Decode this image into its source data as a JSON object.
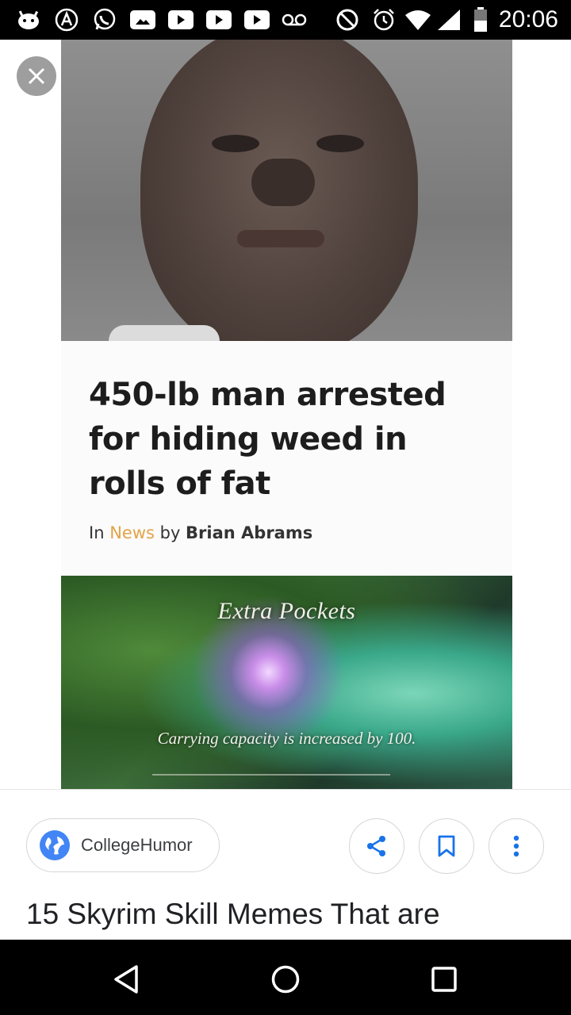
{
  "status_bar": {
    "time": "20:06",
    "icons": [
      "android-debug-icon",
      "app-icon",
      "whatsapp-icon",
      "gallery-icon",
      "youtube-icon",
      "youtube-icon",
      "youtube-icon",
      "voicemail-icon",
      "do-not-disturb-icon",
      "alarm-icon",
      "wifi-icon",
      "signal-icon",
      "battery-icon"
    ]
  },
  "viewer": {
    "close_icon": "close-icon",
    "meme": {
      "headline": "450-lb man arrested for hiding weed in rolls of fat",
      "byline_prefix": "In ",
      "byline_category": "News",
      "byline_mid": " by ",
      "byline_author": "Brian Abrams",
      "perk_title": "Extra Pockets",
      "perk_description": "Carrying capacity is increased by 100."
    }
  },
  "info": {
    "source_name": "CollegeHumor",
    "source_icon": "globe-icon",
    "actions": [
      "share-icon",
      "bookmark-icon",
      "more-vert-icon"
    ],
    "result_title": "15 Skyrim Skill Memes That are"
  },
  "nav_bar": {
    "buttons": [
      "back-icon",
      "home-icon",
      "recents-icon"
    ]
  },
  "colors": {
    "accent": "#4285f4",
    "byline_category": "#e3a34a"
  }
}
